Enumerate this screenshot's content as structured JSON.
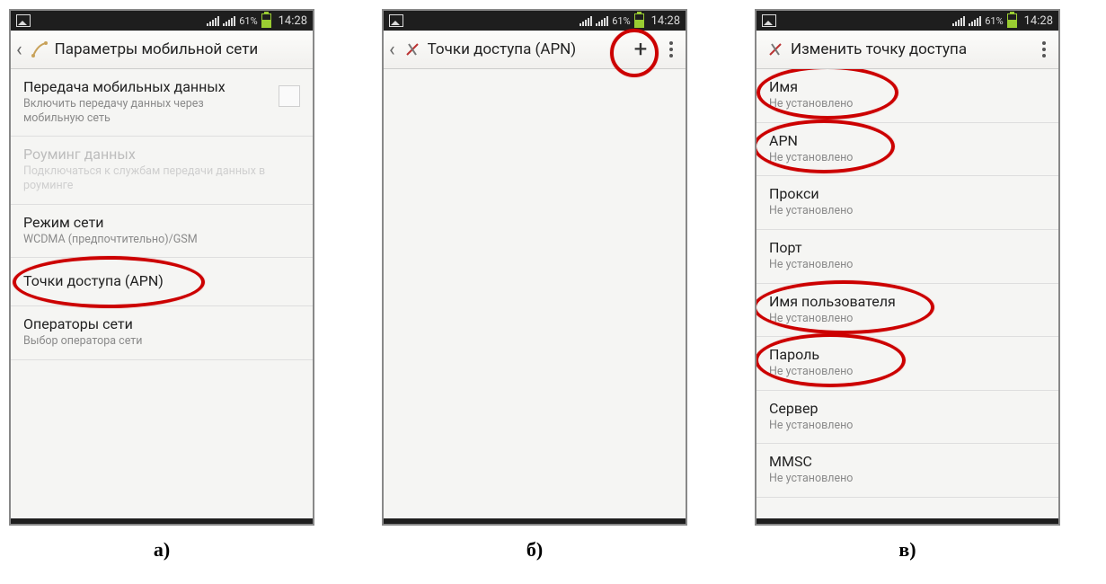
{
  "status": {
    "battery": "61%",
    "time": "14:28"
  },
  "captions": {
    "a": "а)",
    "b": "б)",
    "c": "в)"
  },
  "screenA": {
    "title": "Параметры мобильной сети",
    "items": [
      {
        "primary": "Передача мобильных данных",
        "secondary": "Включить передачу данных через мобильную сеть",
        "checkbox": true
      },
      {
        "primary": "Роуминг данных",
        "secondary": "Подключаться к службам передачи данных в роуминге",
        "disabled": true
      },
      {
        "primary": "Режим сети",
        "secondary": "WCDMA (предпочтительно)/GSM"
      },
      {
        "primary": "Точки доступа (APN)",
        "secondary": "",
        "highlight": true
      },
      {
        "primary": "Операторы сети",
        "secondary": "Выбор оператора сети"
      }
    ]
  },
  "screenB": {
    "title": "Точки доступа (APN)",
    "plusHighlight": true
  },
  "screenC": {
    "title": "Изменить точку доступа",
    "notSet": "Не установлено",
    "items": [
      {
        "primary": "Имя",
        "highlight": true
      },
      {
        "primary": "APN",
        "highlight": true
      },
      {
        "primary": "Прокси"
      },
      {
        "primary": "Порт"
      },
      {
        "primary": "Имя пользователя",
        "highlight": true
      },
      {
        "primary": "Пароль",
        "highlight": true
      },
      {
        "primary": "Сервер"
      },
      {
        "primary": "MMSC"
      }
    ]
  }
}
